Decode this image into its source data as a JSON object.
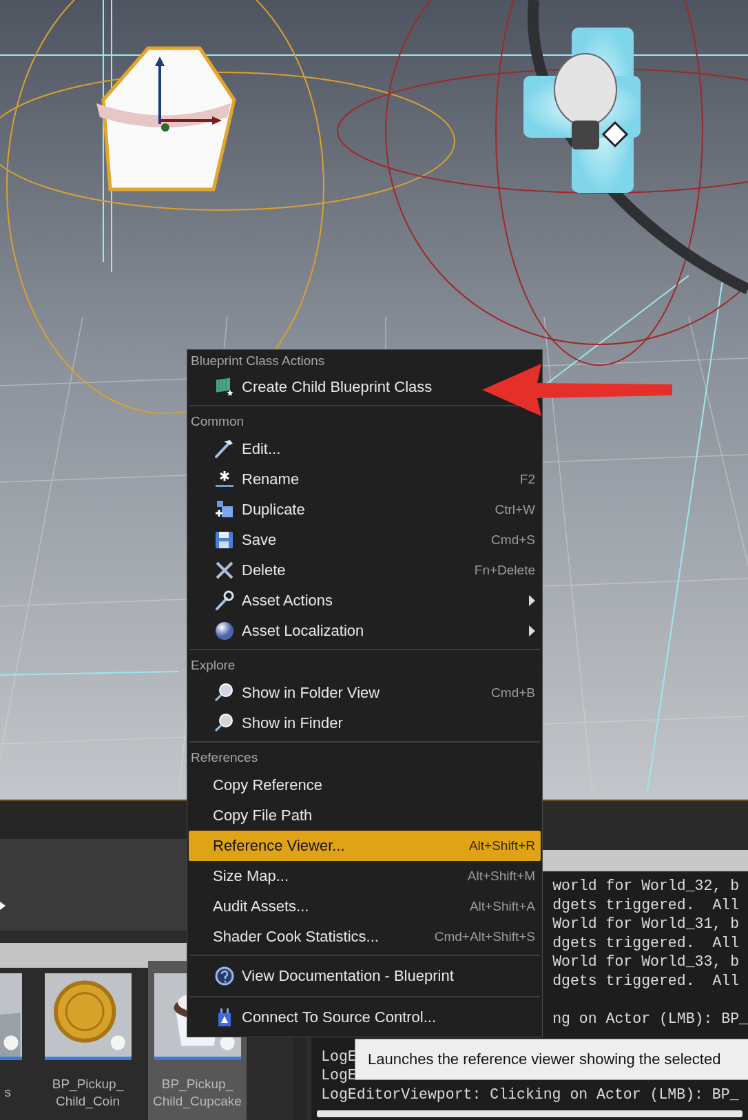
{
  "context_menu": {
    "sections": [
      {
        "header": "Blueprint Class Actions",
        "items": [
          {
            "label": "Create Child Blueprint Class",
            "kind": "icon",
            "submenu": false,
            "selected": false
          }
        ]
      },
      {
        "header": "Common",
        "items": [
          {
            "label": "Edit...",
            "kind": "icon",
            "submenu": false,
            "selected": false
          },
          {
            "label": "Rename",
            "kind": "icon",
            "shortcut": "F2",
            "submenu": false,
            "selected": false
          },
          {
            "label": "Duplicate",
            "kind": "icon",
            "shortcut": "Ctrl+W",
            "submenu": false,
            "selected": false
          },
          {
            "label": "Save",
            "kind": "icon",
            "shortcut": "Cmd+S",
            "submenu": false,
            "selected": false
          },
          {
            "label": "Delete",
            "kind": "icon",
            "shortcut": "Fn+Delete",
            "submenu": false,
            "selected": false
          },
          {
            "label": "Asset Actions",
            "kind": "icon",
            "submenu": true,
            "selected": false
          },
          {
            "label": "Asset Localization",
            "kind": "icon",
            "submenu": true,
            "selected": false
          }
        ]
      },
      {
        "header": "Explore",
        "items": [
          {
            "label": "Show in Folder View",
            "kind": "icon",
            "shortcut": "Cmd+B",
            "submenu": false,
            "selected": false
          },
          {
            "label": "Show in Finder",
            "kind": "icon",
            "submenu": false,
            "selected": false
          }
        ]
      },
      {
        "header": "References",
        "items": [
          {
            "label": "Copy Reference",
            "kind": "plain",
            "submenu": false,
            "selected": false
          },
          {
            "label": "Copy File Path",
            "kind": "plain",
            "submenu": false,
            "selected": false
          },
          {
            "label": "Reference Viewer...",
            "kind": "plain",
            "shortcut": "Alt+Shift+R",
            "submenu": false,
            "selected": true
          },
          {
            "label": "Size Map...",
            "kind": "plain",
            "shortcut": "Alt+Shift+M",
            "submenu": false,
            "selected": false
          },
          {
            "label": "Audit Assets...",
            "kind": "plain",
            "shortcut": "Alt+Shift+A",
            "submenu": false,
            "selected": false
          },
          {
            "label": "Shader Cook Statistics...",
            "kind": "plain",
            "shortcut": "Cmd+Alt+Shift+S",
            "submenu": false,
            "selected": false
          }
        ]
      },
      {
        "items": [
          {
            "label": "View Documentation - Blueprint",
            "kind": "icon",
            "submenu": false,
            "selected": false
          }
        ]
      },
      {
        "items": [
          {
            "label": "Connect To Source Control...",
            "kind": "icon",
            "submenu": false,
            "selected": false
          }
        ]
      }
    ]
  },
  "content_browser": {
    "assets": [
      {
        "label": "s",
        "kind": "partial",
        "selected": false
      },
      {
        "label": "BP_Pickup_\nChild_Coin",
        "kind": "coin",
        "selected": false
      },
      {
        "label": "BP_Pickup_\nChild_Cupcake",
        "kind": "cupcake",
        "selected": true
      }
    ]
  },
  "output_log": {
    "lines": [
      {
        "text": "world for World_32, b",
        "kind": "end"
      },
      {
        "text": "dgets triggered.  All",
        "kind": "end"
      },
      {
        "text": "World for World_31, b",
        "kind": "end"
      },
      {
        "text": "dgets triggered.  All",
        "kind": "end"
      },
      {
        "text": "World for World_33, b",
        "kind": "end"
      },
      {
        "text": "dgets triggered.  All",
        "kind": "end"
      },
      {
        "kind": "blank"
      },
      {
        "text": "ng on Actor (LMB): BP_",
        "kind": "end"
      },
      {
        "kind": "blank"
      },
      {
        "text": "LogE",
        "kind": "start"
      },
      {
        "text": "LogE",
        "kind": "start"
      },
      {
        "text": "LogEditorViewport: Clicking on Actor (LMB): BP_",
        "kind": "whole"
      }
    ]
  },
  "tooltip": {
    "text": "Launches the reference viewer showing the selected"
  }
}
